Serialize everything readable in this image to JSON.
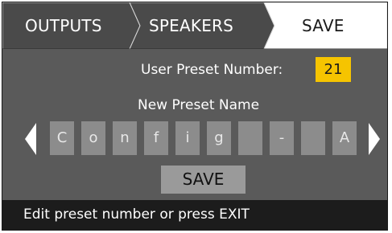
{
  "tabs": {
    "outputs": "OUTPUTS",
    "speakers": "SPEAKERS",
    "save": "SAVE",
    "active": "SAVE"
  },
  "preset": {
    "number_label": "User Preset Number:",
    "number_value": "21",
    "name_label": "New Preset Name",
    "name_chars": [
      "C",
      "o",
      "n",
      "f",
      "i",
      "g",
      "",
      "-",
      "",
      "A"
    ]
  },
  "actions": {
    "save_label": "SAVE"
  },
  "status": {
    "text": "Edit preset number or press EXIT"
  },
  "colors": {
    "background": "#5a5a5a",
    "active_tab": "#ffffff",
    "preset_number_highlight": "#f6c400",
    "char_box": "#8c8c8c",
    "save_button": "#9a9a9a",
    "status_bar": "#1c1c1c"
  },
  "icons": {
    "prev": "arrow-left-icon",
    "next": "arrow-right-icon"
  }
}
